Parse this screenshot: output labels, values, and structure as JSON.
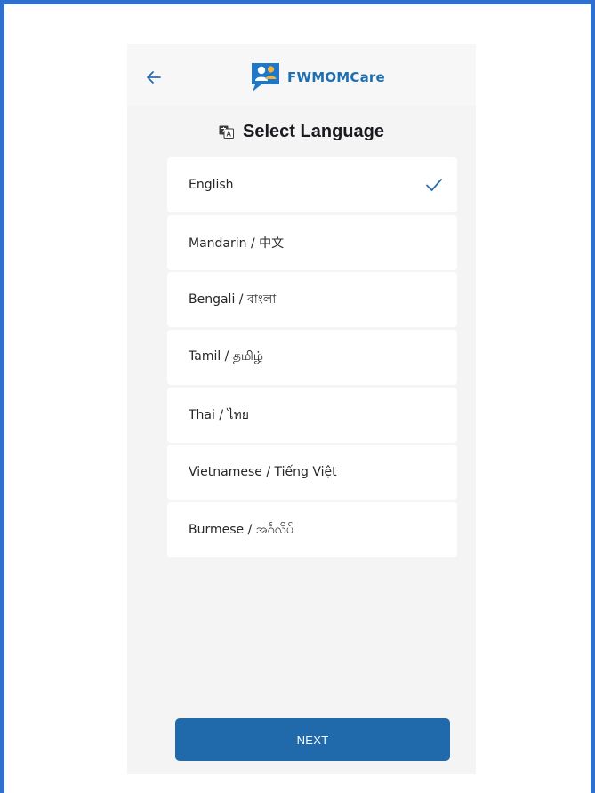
{
  "app": {
    "name": "FWMOMCare",
    "brand_color": "#1f6fb0",
    "accent_color": "#2069aa"
  },
  "header": {
    "back_icon": "arrow-left-icon",
    "logo_icon": "fwmomcare-logo-icon"
  },
  "page": {
    "title_icon": "language-icon",
    "title": "Select Language"
  },
  "languages": [
    {
      "label": "English",
      "selected": true
    },
    {
      "label": "Mandarin / 中文",
      "selected": false
    },
    {
      "label": "Bengali / বাংলা",
      "selected": false
    },
    {
      "label": "Tamil / தமிழ்",
      "selected": false
    },
    {
      "label": "Thai / ไทย",
      "selected": false
    },
    {
      "label": "Vietnamese / Tiếng Việt",
      "selected": false
    },
    {
      "label": "Burmese / အင်္ဂလိပ်",
      "selected": false
    }
  ],
  "selected_icon": "checkmark-icon",
  "footer": {
    "next_label": "NEXT"
  }
}
